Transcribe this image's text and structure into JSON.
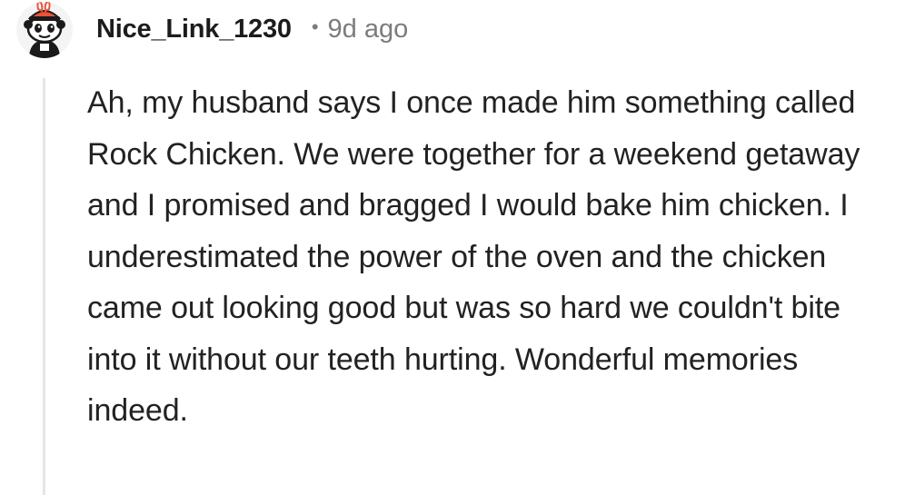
{
  "comment": {
    "author": "Nice_Link_1230",
    "separator": "•",
    "time_ago": "9d ago",
    "avatar_icon": "snoo-avatar-icon",
    "body": "Ah, my husband says I once made him something called Rock Chicken. We were together for a weekend getaway and I promised and bragged I would bake him chicken. I underestimated the power of the oven and the chicken came out looking good but was so hard we couldn't bite into it without our teeth hurting. Wonderful memories indeed."
  },
  "colors": {
    "username": "#1c1c1c",
    "meta": "#7c7c7c",
    "body": "#222222",
    "thread_line": "#e6e6e6",
    "avatar_accent": "#e8533a"
  }
}
